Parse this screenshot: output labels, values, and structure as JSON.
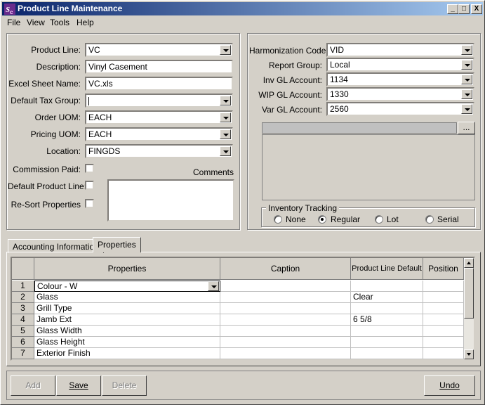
{
  "title": "Product Line Maintenance",
  "window_buttons": {
    "minimize": "_",
    "maximize": "□",
    "close": "X"
  },
  "menu": [
    "File",
    "View",
    "Tools",
    "Help"
  ],
  "left": {
    "product_line": {
      "label": "Product Line:",
      "value": "VC"
    },
    "description": {
      "label": "Description:",
      "value": "Vinyl Casement"
    },
    "excel_sheet": {
      "label": "Excel Sheet Name:",
      "value": "VC.xls"
    },
    "tax_group": {
      "label": "Default Tax Group:",
      "value": ""
    },
    "order_uom": {
      "label": "Order UOM:",
      "value": "EACH"
    },
    "pricing_uom": {
      "label": "Pricing UOM:",
      "value": "EACH"
    },
    "location": {
      "label": "Location:",
      "value": "FINGDS"
    },
    "commission_paid": {
      "label": "Commission Paid:",
      "checked": false
    },
    "default_product_line": {
      "label": "Default Product Line:",
      "checked": false
    },
    "resort_properties": {
      "label": "Re-Sort Properties",
      "checked": false
    },
    "comments_label": "Comments"
  },
  "right": {
    "harmonization": {
      "label": "Harmonization Code:",
      "value": "VID"
    },
    "report_group": {
      "label": "Report Group:",
      "value": "Local"
    },
    "inv_gl": {
      "label": "Inv GL Account:",
      "value": "1134"
    },
    "wip_gl": {
      "label": "WIP GL Account:",
      "value": "1330"
    },
    "var_gl": {
      "label": "Var GL Account:",
      "value": "2560"
    },
    "browse_label": "...",
    "inventory_tracking": {
      "label": "Inventory Tracking",
      "options": [
        "None",
        "Regular",
        "Lot",
        "Serial"
      ],
      "selected": "Regular"
    }
  },
  "tabs": [
    "Accounting Information",
    "Properties"
  ],
  "active_tab": "Properties",
  "grid": {
    "columns": [
      "Properties",
      "Caption",
      "Product Line Default",
      "Position"
    ],
    "rows": [
      {
        "num": "1",
        "property": "Colour - W",
        "caption": "",
        "default": "",
        "position": ""
      },
      {
        "num": "2",
        "property": "Glass",
        "caption": "",
        "default": "Clear",
        "position": ""
      },
      {
        "num": "3",
        "property": "Grill Type",
        "caption": "",
        "default": "",
        "position": ""
      },
      {
        "num": "4",
        "property": "Jamb Ext",
        "caption": "",
        "default": "6 5/8",
        "position": ""
      },
      {
        "num": "5",
        "property": "Glass Width",
        "caption": "",
        "default": "",
        "position": ""
      },
      {
        "num": "6",
        "property": "Glass Height",
        "caption": "",
        "default": "",
        "position": ""
      },
      {
        "num": "7",
        "property": "Exterior Finish",
        "caption": "",
        "default": "",
        "position": ""
      }
    ]
  },
  "buttons": {
    "add": "Add",
    "save": "Save",
    "delete": "Delete",
    "undo": "Undo"
  }
}
